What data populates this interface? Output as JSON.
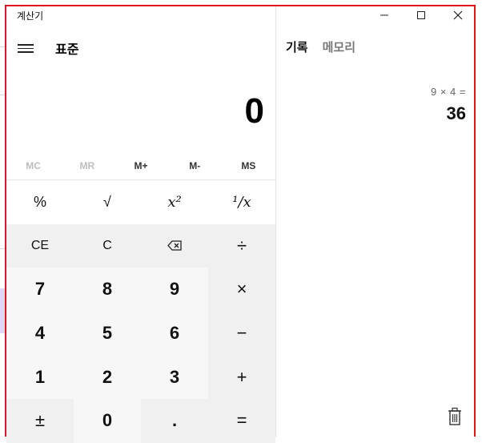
{
  "window": {
    "title": "계산기"
  },
  "header": {
    "mode": "표준"
  },
  "display": {
    "value": "0"
  },
  "memory": {
    "buttons": [
      {
        "label": "MC",
        "enabled": false
      },
      {
        "label": "MR",
        "enabled": false
      },
      {
        "label": "M+",
        "enabled": true
      },
      {
        "label": "M-",
        "enabled": true
      },
      {
        "label": "MS",
        "enabled": true
      }
    ]
  },
  "keypad": {
    "row1": [
      "%",
      "√",
      "x²",
      "¹/x"
    ],
    "row2": [
      "CE",
      "C",
      "⌫",
      "÷"
    ],
    "row3": [
      "7",
      "8",
      "9",
      "×"
    ],
    "row4": [
      "4",
      "5",
      "6",
      "−"
    ],
    "row5": [
      "1",
      "2",
      "3",
      "+"
    ],
    "row6": [
      "±",
      "0",
      ".",
      "="
    ]
  },
  "side": {
    "tabs": [
      "기록",
      "메모리"
    ],
    "history": {
      "expression": "9   ×   4 =",
      "result": "36"
    }
  },
  "colors": {
    "border": "#e0161c",
    "keypad_gray": "#f0f0f0",
    "number_key": "#f7f7f7",
    "disabled_text": "#bdbdbd"
  }
}
